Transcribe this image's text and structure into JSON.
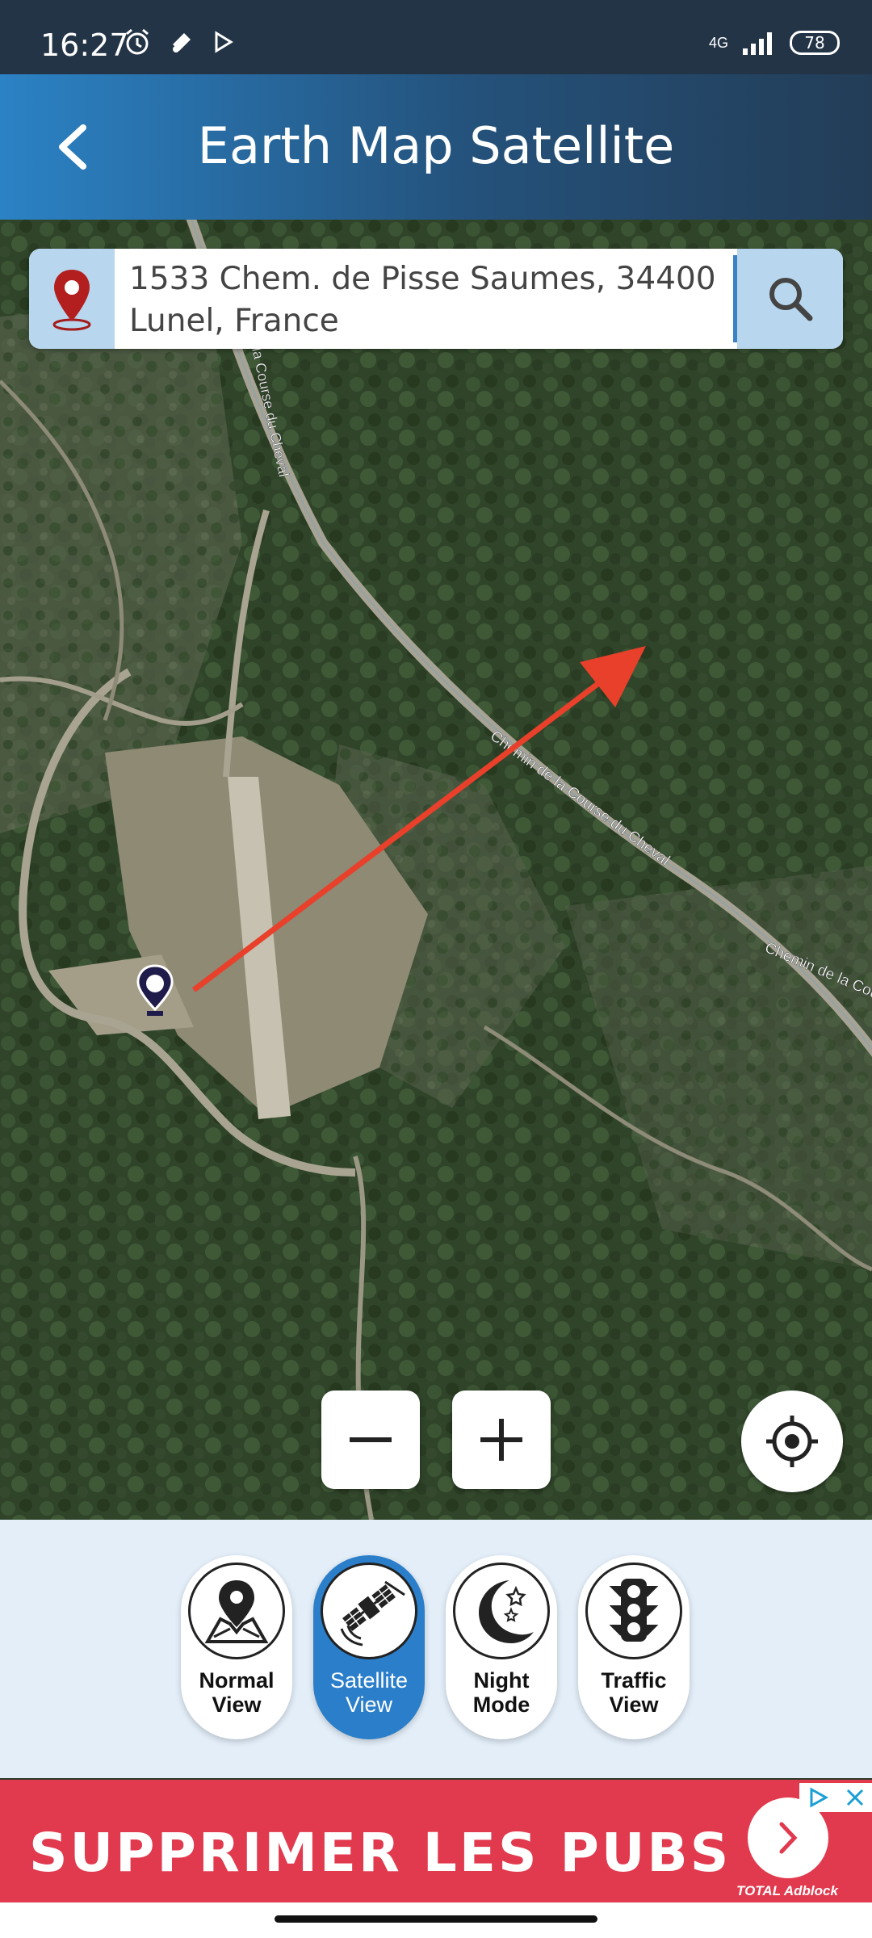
{
  "status_bar": {
    "time": "16:27",
    "network": "4G",
    "battery": "78",
    "icons": [
      "alarm-icon",
      "notification-icon",
      "play-store-icon",
      "signal-icon",
      "battery-icon"
    ]
  },
  "app_bar": {
    "title": "Earth Map Satellite",
    "back_icon": "back-arrow-icon"
  },
  "search": {
    "address": "1533 Chem. de Pisse Saumes, 34400 Lunel, France",
    "pin_icon": "location-pin-icon",
    "search_icon": "search-icon"
  },
  "map": {
    "roads": [
      {
        "label": "la Course du Cheval"
      },
      {
        "label": "Chemin de la Course du Cheval"
      },
      {
        "label": "Chemin de la Cou"
      }
    ]
  },
  "controls": {
    "zoom_out_icon": "minus-icon",
    "zoom_in_icon": "plus-icon",
    "locate_icon": "my-location-icon"
  },
  "modes": [
    {
      "line1": "Normal",
      "line2": "View",
      "active": false,
      "icon": "map-pin-icon"
    },
    {
      "line1": "Satellite",
      "line2": "View",
      "active": true,
      "icon": "satellite-icon"
    },
    {
      "line1": "Night",
      "line2": "Mode",
      "active": false,
      "icon": "moon-stars-icon"
    },
    {
      "line1": "Traffic",
      "line2": "View",
      "active": false,
      "icon": "traffic-light-icon"
    }
  ],
  "ad": {
    "text": "SUPPRIMER LES PUBS",
    "brand": "TOTAL Adblock",
    "colors": {
      "banner": "#e1394d"
    }
  },
  "colors": {
    "app_bar_start": "#2b82c5",
    "app_bar_end": "#233d57",
    "accent": "#2b7ec9",
    "panel": "#e3eef9",
    "route_arrow": "#e8402a"
  }
}
